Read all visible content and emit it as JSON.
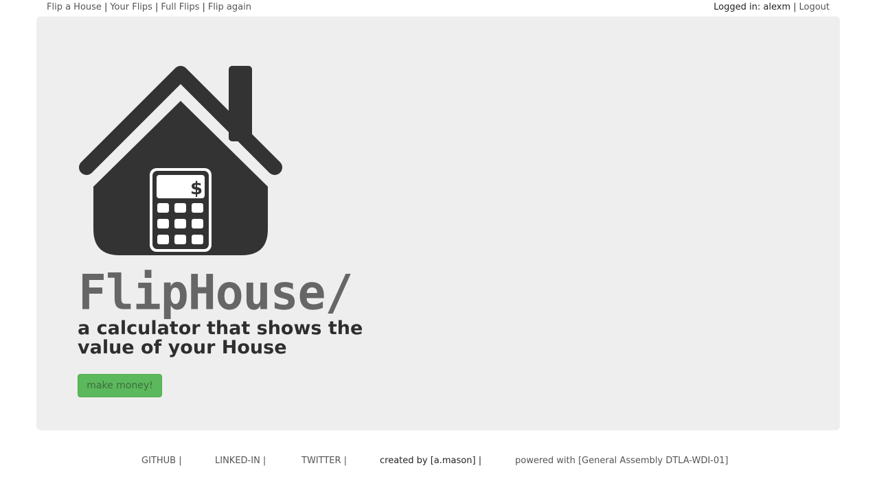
{
  "nav": {
    "links": [
      "Flip a House",
      "Your Flips",
      "Full Flips",
      "Flip again"
    ],
    "separator": "|",
    "logged_in_label": "Logged in: alexm",
    "logout_label": "Logout"
  },
  "hero": {
    "logo_icon": "house-calculator-icon",
    "brand": "FlipHouse/",
    "tagline": "a calculator that shows the value of your House",
    "cta_label": "make money!"
  },
  "footer": {
    "github": "GITHUB |",
    "linkedin": "LINKED-IN |",
    "twitter": "TWITTER |",
    "created": "created by [a.mason] |",
    "powered": "powered with [General Assembly DTLA-WDI-01]"
  },
  "colors": {
    "panel": "#eeeeee",
    "icon": "#333333",
    "cta": "#5cb85c"
  }
}
